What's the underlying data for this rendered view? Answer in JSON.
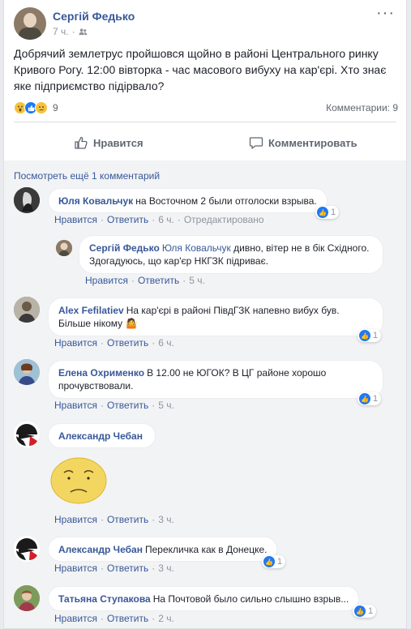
{
  "post": {
    "author": "Сергій Федько",
    "time": "7 ч.",
    "meta_separator": "·",
    "text": "Добрячий землетрус пройшовся щойно в районі Центрального ринку Кривого Рогу. 12:00 вівторка - час масового вибуху на кар'єрі. Хто знає яке підприємство підірвало?",
    "reactions_count": "9",
    "comments_count": "Комментарии: 9",
    "like_label": "Нравится",
    "comment_label": "Комментировать"
  },
  "view_more": "Посмотреть ещё 1 комментарий",
  "comments": [
    {
      "author": "Юля Ковальчук",
      "text": "на Восточном 2 были отголоски взрыва.",
      "like": "Нравится",
      "reply": "Ответить",
      "time": "6 ч.",
      "edited": "Отредактировано",
      "reactions": "1"
    },
    {
      "author": "Сергій Федько",
      "mention": "Юля Ковальчук",
      "text": "дивно, вітер не в бік Східного. Здогадуюсь, що кар'єр НКГЗК підриває.",
      "like": "Нравится",
      "reply": "Ответить",
      "time": "5 ч."
    },
    {
      "author": "Alex Fefilatiev",
      "text": "На кар'єрі в районі ПівдГЗК напевно вибух був. Більше нікому",
      "emoji": "🤷",
      "like": "Нравится",
      "reply": "Ответить",
      "time": "6 ч.",
      "reactions": "1"
    },
    {
      "author": "Елена Охрименко",
      "text": "В 12.00 не ЮГОК? В ЦГ районе хорошо прочувствовали.",
      "like": "Нравится",
      "reply": "Ответить",
      "time": "5 ч.",
      "reactions": "1"
    },
    {
      "author": "Александр Чебан",
      "text": "",
      "like": "Нравится",
      "reply": "Ответить",
      "time": "3 ч."
    },
    {
      "author": "Александр Чебан",
      "text": "Перекличка как в Донецке.",
      "like": "Нравится",
      "reply": "Ответить",
      "time": "3 ч.",
      "reactions": "1"
    },
    {
      "author": "Татьяна Ступакова",
      "text": "На Почтовой было сильно слышно взрыв...",
      "like": "Нравится",
      "reply": "Ответить",
      "time": "2 ч.",
      "reactions": "1"
    }
  ],
  "meta_dot": "·",
  "colors": {
    "link": "#385898",
    "muted": "#90949c",
    "like_blue": "#2078f4",
    "comment_bg": "#f2f3f5"
  },
  "icons": {
    "friends": "friends-icon",
    "like": "thumbs-up-icon",
    "comment": "comment-bubble-icon",
    "more": "more-options-icon"
  }
}
